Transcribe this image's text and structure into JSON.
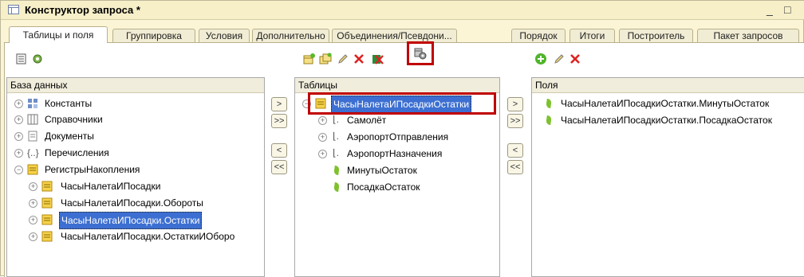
{
  "window": {
    "title": "Конструктор запроса *",
    "min": "_",
    "max": "□"
  },
  "tabs": [
    "Таблицы и поля",
    "Группировка",
    "Условия",
    "Дополнительно",
    "Объединения/Псевдони...",
    "Порядок",
    "Итоги",
    "Построитель",
    "Пакет запросов"
  ],
  "database": {
    "header": "База данных",
    "items": [
      "Константы",
      "Справочники",
      "Документы",
      "Перечисления",
      "РегистрыНакопления",
      "ЧасыНалетаИПосадки",
      "ЧасыНалетаИПосадки.Обороты",
      "ЧасыНалетаИПосадки.Остатки",
      "ЧасыНалетаИПосадки.ОстаткиИОборо"
    ]
  },
  "tables": {
    "header": "Таблицы",
    "root": "ЧасыНалетаИПосадкиОстатки",
    "children": [
      "Самолёт",
      "АэропортОтправления",
      "АэропортНазначения",
      "МинутыОстаток",
      "ПосадкаОстаток"
    ]
  },
  "fields": {
    "header": "Поля",
    "items": [
      "ЧасыНалетаИПосадкиОстатки.МинутыОстаток",
      "ЧасыНалетаИПосадкиОстатки.ПосадкаОстаток"
    ]
  },
  "move_buttons": {
    "add": ">",
    "add_all": ">>",
    "remove": "<",
    "remove_all": "<<"
  },
  "colors": {
    "highlight": "#c00000",
    "selection": "#3c6fd1",
    "window_bg": "#fbf5d6"
  },
  "icons": [
    "list-icon",
    "tree-settings-icon",
    "add-table-icon",
    "add-nested-table-icon",
    "edit-pencil-icon",
    "delete-icon",
    "excel-delete-icon",
    "table-settings-icon",
    "add-plus-icon"
  ]
}
